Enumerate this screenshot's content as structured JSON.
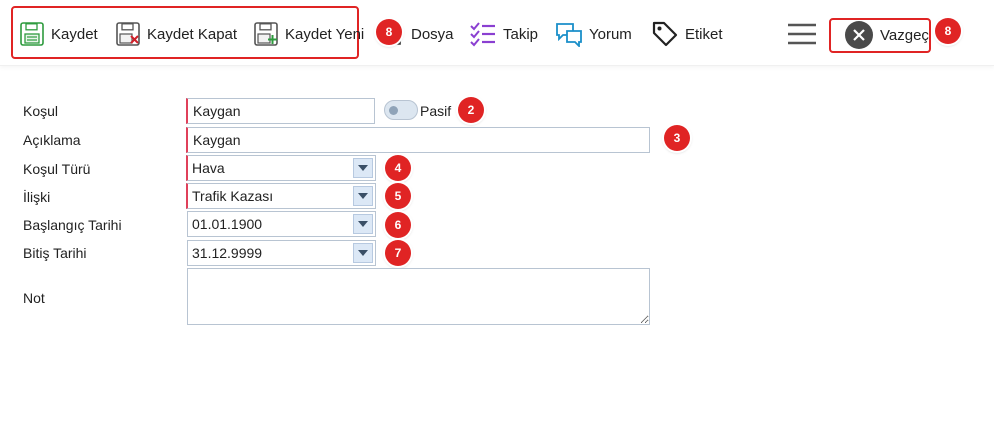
{
  "toolbar": {
    "save_label": "Kaydet",
    "save_close_label": "Kaydet Kapat",
    "save_new_label": "Kaydet Yeni",
    "file_label": "Dosya",
    "follow_label": "Takip",
    "comment_label": "Yorum",
    "tag_label": "Etiket",
    "cancel_label": "Vazgeç"
  },
  "form": {
    "condition_label": "Koşul",
    "condition_value": "Kaygan",
    "passive_label": "Pasif",
    "description_label": "Açıklama",
    "description_value": "Kaygan",
    "condition_type_label": "Koşul Türü",
    "condition_type_value": "Hava",
    "relation_label": "İlişki",
    "relation_value": "Trafik Kazası",
    "start_date_label": "Başlangıç Tarihi",
    "start_date_value": "01.01.1900",
    "end_date_label": "Bitiş Tarihi",
    "end_date_value": "31.12.9999",
    "note_label": "Not",
    "note_value": ""
  },
  "annotations": {
    "toolbar_group": "8",
    "passive": "2",
    "description": "3",
    "condition_type": "4",
    "relation": "5",
    "start_date": "6",
    "end_date": "7",
    "cancel": "8"
  },
  "colors": {
    "annotation_red": "#e02424",
    "required_marker": "#e0405a",
    "save_icon_green": "#2e9b3e",
    "follow_icon_purple": "#8a3fd1",
    "comment_icon_teal": "#1a8fc9"
  },
  "icons": {
    "save": "floppy-save-icon",
    "save_close": "floppy-close-icon",
    "save_new": "floppy-new-icon",
    "file": "file-icon",
    "follow": "checklist-icon",
    "comment": "chat-bubbles-icon",
    "tag": "tag-icon",
    "menu": "hamburger-icon",
    "cancel": "close-circle-icon"
  }
}
